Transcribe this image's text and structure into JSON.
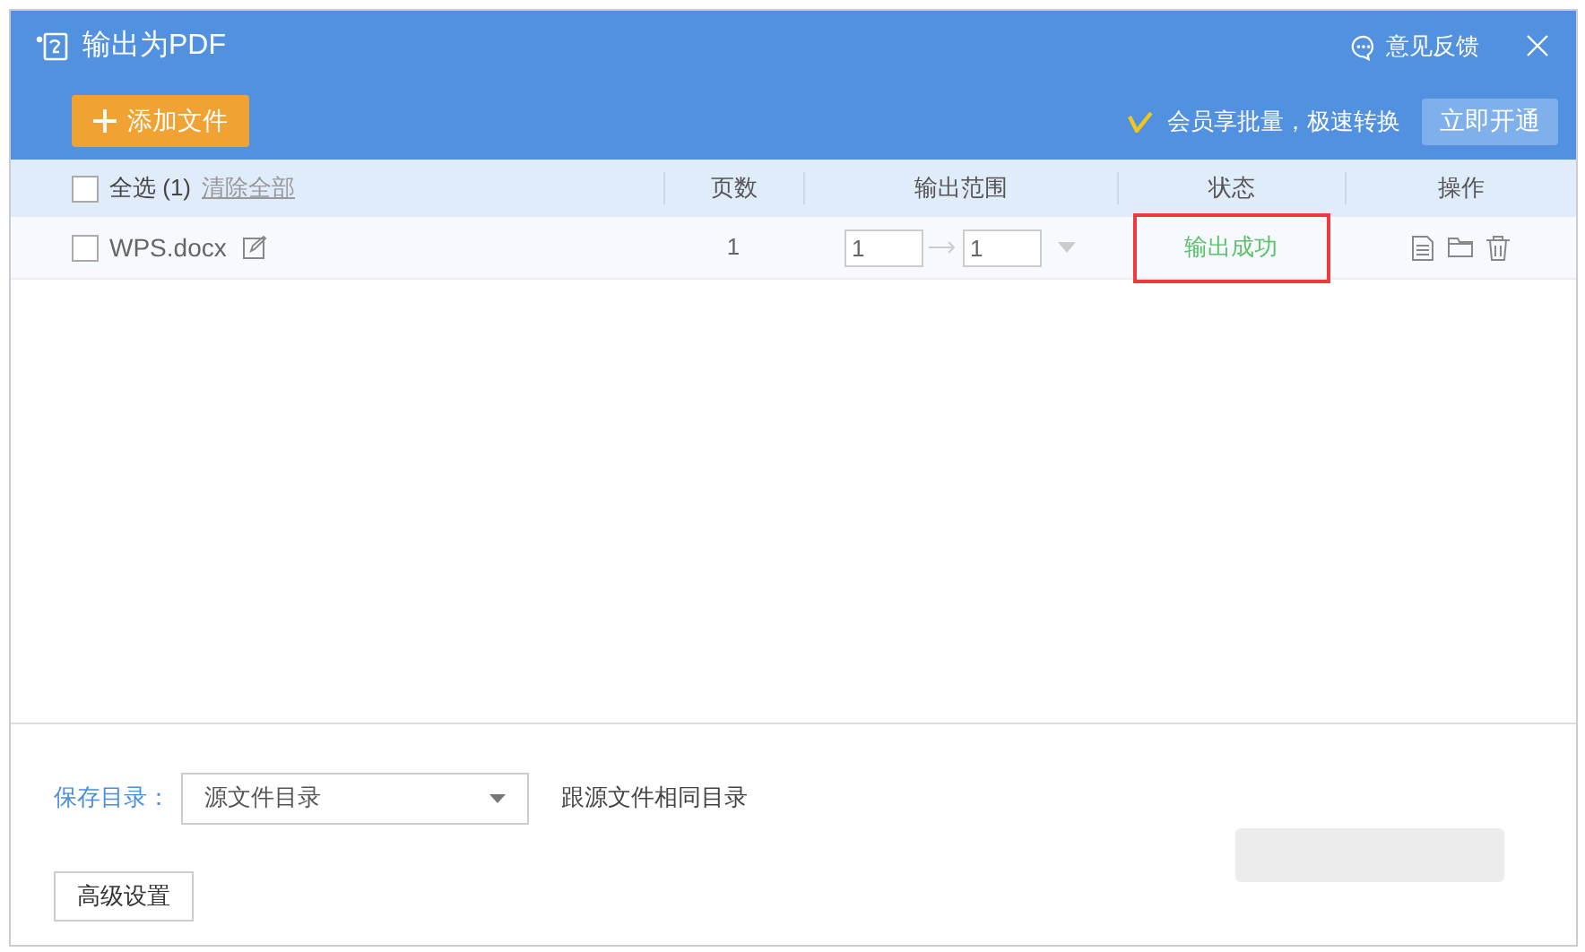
{
  "window": {
    "title": "输出为PDF",
    "feedback": "意见反馈"
  },
  "toolbar": {
    "add_button": "添加文件",
    "promo": "会员享批量，极速转换",
    "promo_button": "立即开通"
  },
  "table": {
    "select_all": {
      "label": "全选 (1)",
      "checked": false
    },
    "clear_link": "清除全部",
    "columns": [
      "页数",
      "输出范围",
      "状态",
      "操作"
    ],
    "rows": [
      {
        "name": "WPS.docx",
        "checked": false,
        "pages": "1",
        "from": "1",
        "to": "1",
        "status": "输出成功",
        "highlighted": true
      }
    ]
  },
  "footer": {
    "save_label": "保存目录：",
    "save_select": "源文件目录",
    "save_hint": "跟源文件相同目录",
    "advanced_button": "高级设置"
  }
}
